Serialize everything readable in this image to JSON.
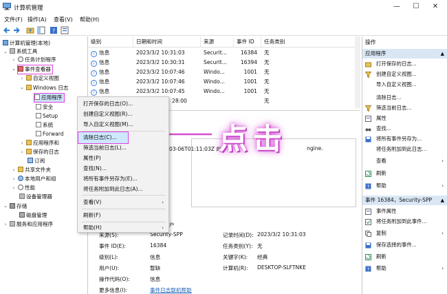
{
  "window": {
    "title": "计算机管理",
    "min": "—",
    "max": "☐",
    "close": "✕"
  },
  "menu": [
    "文件(F)",
    "操作(A)",
    "查看(V)",
    "帮助(H)"
  ],
  "tree": {
    "root": "计算机管理(本地)",
    "system_tools": "系统工具",
    "task_scheduler": "任务计划程序",
    "event_viewer": "事件查看器",
    "custom_views": "自定义视图",
    "windows_logs": "Windows 日志",
    "application": "应用程序",
    "security": "安全",
    "setup": "Setup",
    "system": "系统",
    "forwarded": "Forward",
    "app_service_logs": "应用程序和",
    "saved_logs": "保存的日志",
    "subscriptions": "订阅",
    "shared_folders": "共享文件夹",
    "local_users": "本地用户和组",
    "performance": "性能",
    "device_manager": "设备管理器",
    "storage": "存储",
    "disk_management": "磁盘管理",
    "services": "服务和应用程序"
  },
  "table": {
    "headers": [
      "级别",
      "日期和时间",
      "来源",
      "事件 ID",
      "任务类别"
    ],
    "rows": [
      [
        "信息",
        "2023/3/2 10:31:03",
        "Securit...",
        "16384",
        "无"
      ],
      [
        "信息",
        "2023/3/2 10:30:31",
        "Securit...",
        "16394",
        "无"
      ],
      [
        "信息",
        "2023/3/2 10:07:46",
        "Windo...",
        "1001",
        "无"
      ],
      [
        "信息",
        "2023/3/2 10:07:46",
        "Windo...",
        "1001",
        "无"
      ],
      [
        "信息",
        "2023/3/2 10:07:45",
        "Windo...",
        "1001",
        "无"
      ],
      [
        "",
        "28:00",
        "",
        "",
        "无"
      ]
    ]
  },
  "context_menu": {
    "items": [
      "打开保存的日志(O)...",
      "创建自定义视图(R)...",
      "导入自定义视图(M)...",
      "清除日志(C)...",
      "筛选当前日志(L)...",
      "属性(P)",
      "查找(N)...",
      "将所有事件另存为(E)...",
      "将任务附加到此日志(A)...",
      "查看(V)",
      "刷新(F)",
      "帮助(H)"
    ],
    "submenu_arrow": "›"
  },
  "detail": {
    "snippet_date": "03-06T01:11:03Z 的",
    "snippet_engine": "ngine.",
    "log_name_label": "来源(S):",
    "log_name_value": "Security-SPP",
    "recorded_label": "记录时间(D):",
    "recorded_value": "2023/3/2 10:31:03",
    "event_id_label": "事件 ID(E):",
    "event_id_value": "16384",
    "task_label": "任务类别(Y):",
    "task_value": "无",
    "level_label": "级别(L):",
    "level_value": "信息",
    "keywords_label": "关键字(K):",
    "keywords_value": "经典",
    "user_label": "用户(U):",
    "user_value": "暂缺",
    "computer_label": "计算机(R):",
    "computer_value": "DESKTOP-SLFTNKE",
    "opcode_label": "操作代码(O):",
    "opcode_value": "信息",
    "more_label": "更多信息(I):",
    "more_link": "事件日志联机帮助",
    "partial_header": "户"
  },
  "actions": {
    "title": "操作",
    "section1": "应用程序",
    "items1": [
      "打开保存的日志...",
      "创建自定义视图...",
      "导入自定义视图...",
      "清除日志...",
      "筛选当前日志...",
      "属性",
      "查找...",
      "将所有事件另存为...",
      "将任务附加到此日志...",
      "查看",
      "刷新",
      "帮助"
    ],
    "section2": "事件 16384，Security-SPP",
    "items2": [
      "事件属性",
      "将任务附加到此事件...",
      "复制",
      "保存选择的事件...",
      "刷新",
      "帮助"
    ]
  },
  "annotation": {
    "label": "点击"
  },
  "colors": {
    "highlight": "#e040e0",
    "selection": "#cde8ff",
    "section": "#d9e7f5",
    "annotation": "#d34fd1"
  }
}
